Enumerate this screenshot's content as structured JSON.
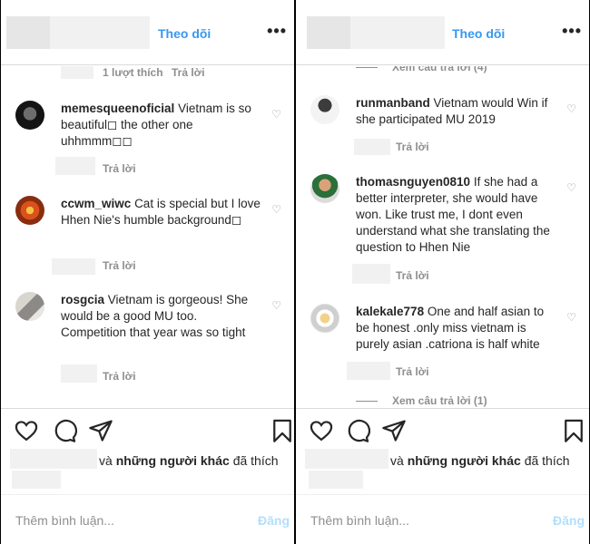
{
  "left": {
    "header": {
      "follow": "Theo dõi",
      "more": "•••"
    },
    "top_meta": {
      "likes": "1 lượt thích",
      "reply": "Trả lời"
    },
    "comments": [
      {
        "user": "memesqueenoficial",
        "text": "Vietnam is so beautiful◻ the other one uhhmmm◻◻",
        "reply": "Trả lời"
      },
      {
        "user": "ccwm_wiwc",
        "text": "Cat is special but I love Hhen Nie's humble background◻",
        "reply": "Trả lời"
      },
      {
        "user": "rosgcia",
        "text": "Vietnam is gorgeous! She would be a good MU too. Competition that year was so tight",
        "reply": "Trả lời"
      }
    ],
    "liked_by": {
      "connector": "và",
      "others": "những người khác",
      "suffix": "đã thích"
    },
    "comment_input": {
      "placeholder": "Thêm bình luận...",
      "post": "Đăng"
    }
  },
  "right": {
    "header": {
      "follow": "Theo dõi",
      "more": "•••"
    },
    "top_view_replies": "Xem câu trả lời (4)",
    "comments": [
      {
        "user": "runmanband",
        "text": "Vietnam would Win if she participated MU 2019",
        "reply": "Trả lời"
      },
      {
        "user": "thomasnguyen0810",
        "text": "If she had a better interpreter, she would have won. Like trust me, I dont even understand what she translating the question to Hhen Nie",
        "reply": "Trả lời"
      },
      {
        "user": "kalekale778",
        "text": "One and half asian to be honest .only miss vietnam is purely asian .catriona is half white",
        "reply": "Trả lời"
      }
    ],
    "bottom_view_replies": "Xem câu trả lời (1)",
    "liked_by": {
      "connector": "và",
      "others": "những người khác",
      "suffix": "đã thích"
    },
    "comment_input": {
      "placeholder": "Thêm bình luận...",
      "post": "Đăng"
    }
  }
}
